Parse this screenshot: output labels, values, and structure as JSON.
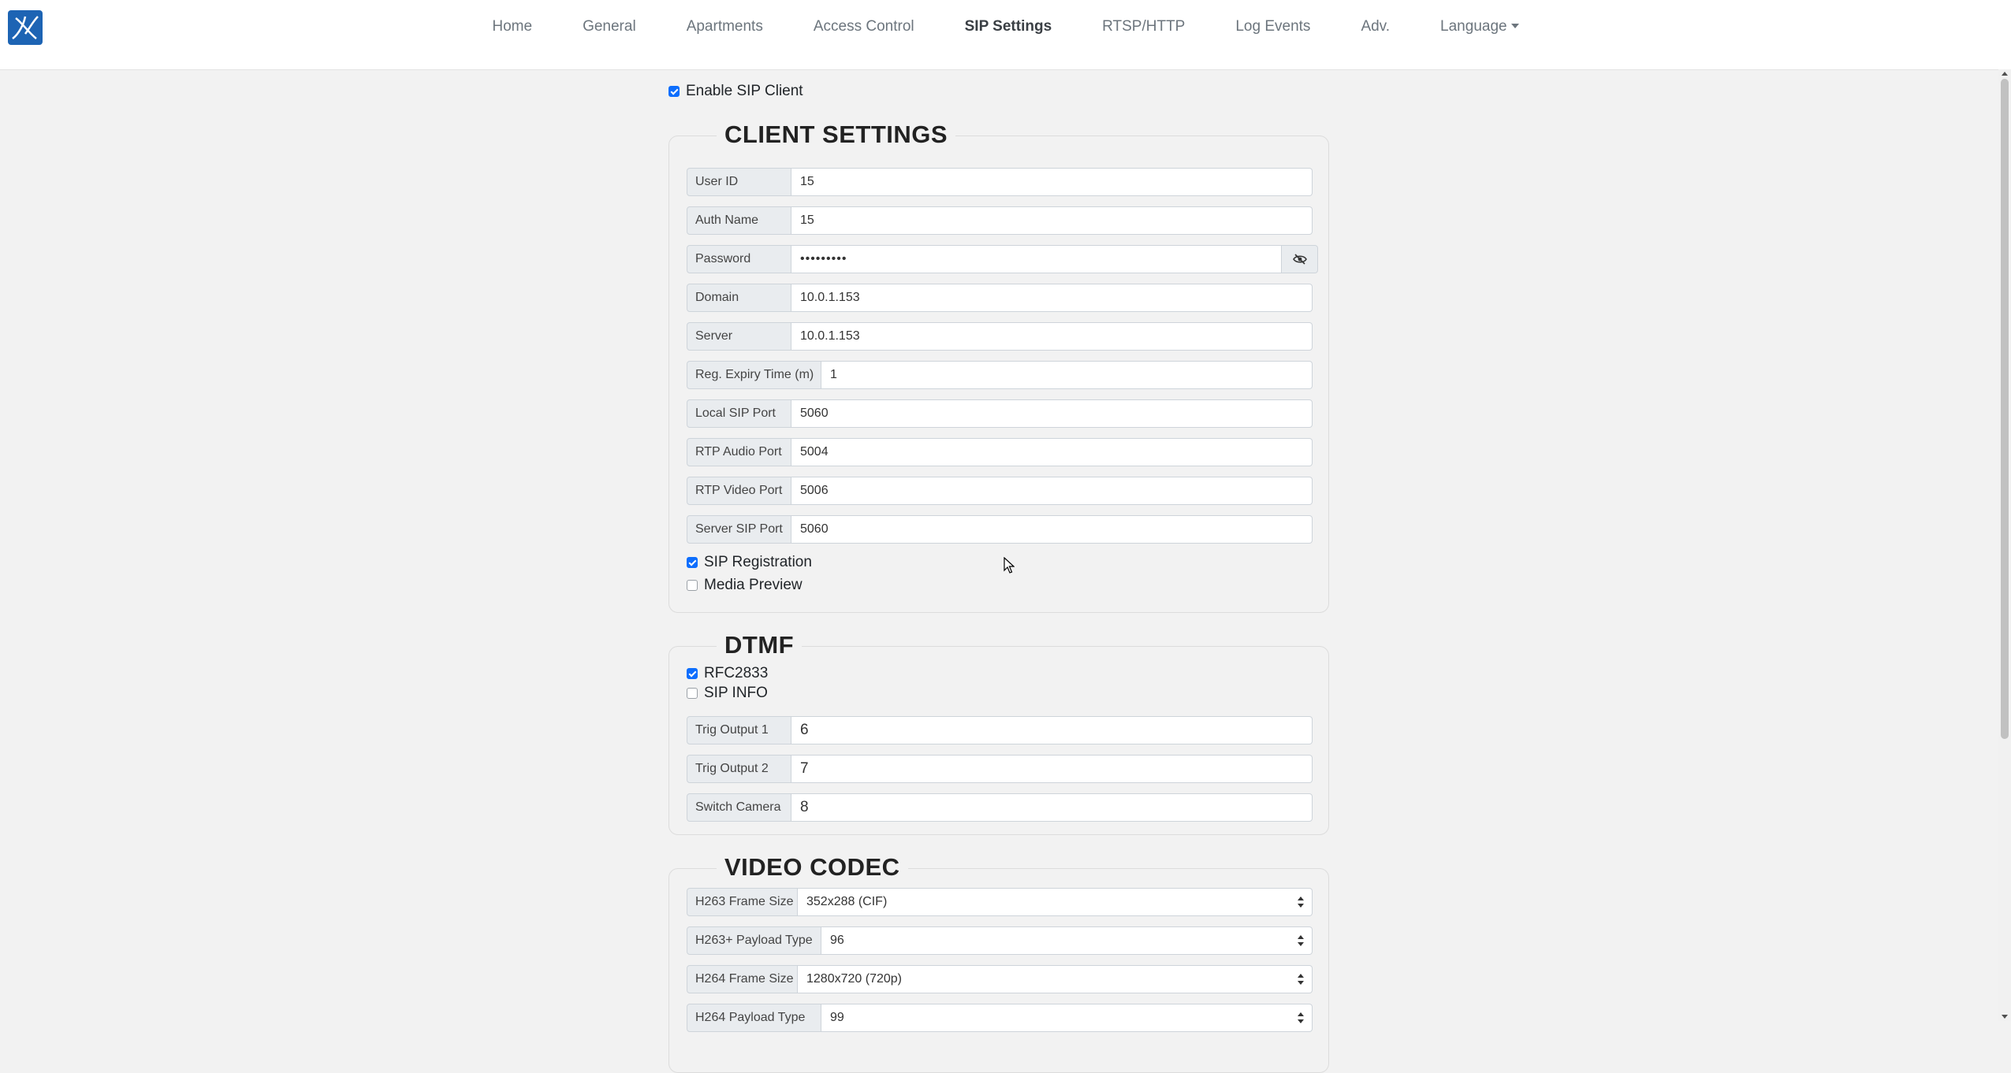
{
  "nav": {
    "items": [
      "Home",
      "General",
      "Apartments",
      "Access Control",
      "SIP Settings",
      "RTSP/HTTP",
      "Log Events",
      "Adv."
    ],
    "active": "SIP Settings",
    "language_label": "Language"
  },
  "enable_sip": {
    "label": "Enable SIP Client",
    "checked": true
  },
  "client_settings": {
    "title": "CLIENT SETTINGS",
    "fields": [
      {
        "label": "User ID",
        "value": "15"
      },
      {
        "label": "Auth Name",
        "value": "15"
      },
      {
        "label": "Password",
        "value": "•••••••••"
      },
      {
        "label": "Domain",
        "value": "10.0.1.153"
      },
      {
        "label": "Server",
        "value": "10.0.1.153"
      },
      {
        "label": "Reg. Expiry Time (m)",
        "value": "1"
      },
      {
        "label": "Local SIP Port",
        "value": "5060"
      },
      {
        "label": "RTP Audio Port",
        "value": "5004"
      },
      {
        "label": "RTP Video Port",
        "value": "5006"
      },
      {
        "label": "Server SIP Port",
        "value": "5060"
      }
    ],
    "checkboxes": [
      {
        "label": "SIP Registration",
        "checked": true
      },
      {
        "label": "Media Preview",
        "checked": false
      }
    ]
  },
  "dtmf": {
    "title": "DTMF",
    "checkboxes": [
      {
        "label": "RFC2833",
        "checked": true
      },
      {
        "label": "SIP INFO",
        "checked": false
      }
    ],
    "fields": [
      {
        "label": "Trig Output 1",
        "value": "6"
      },
      {
        "label": "Trig Output 2",
        "value": "7"
      },
      {
        "label": "Switch Camera",
        "value": "8"
      }
    ]
  },
  "video_codec": {
    "title": "VIDEO CODEC",
    "selects": [
      {
        "label": "H263 Frame Size",
        "value": "352x288 (CIF)"
      },
      {
        "label": "H263+ Payload Type",
        "value": "96"
      },
      {
        "label": "H264 Frame Size",
        "value": "1280x720 (720p)"
      },
      {
        "label": "H264 Payload Type",
        "value": "99"
      }
    ]
  },
  "colors": {
    "accent": "#0d6efd",
    "logo_bg": "#1d64b4",
    "page_bg": "#f2f2f2"
  },
  "icons": {
    "password_toggle": "eye-slash-icon",
    "logo": "brand-logo-icon"
  }
}
